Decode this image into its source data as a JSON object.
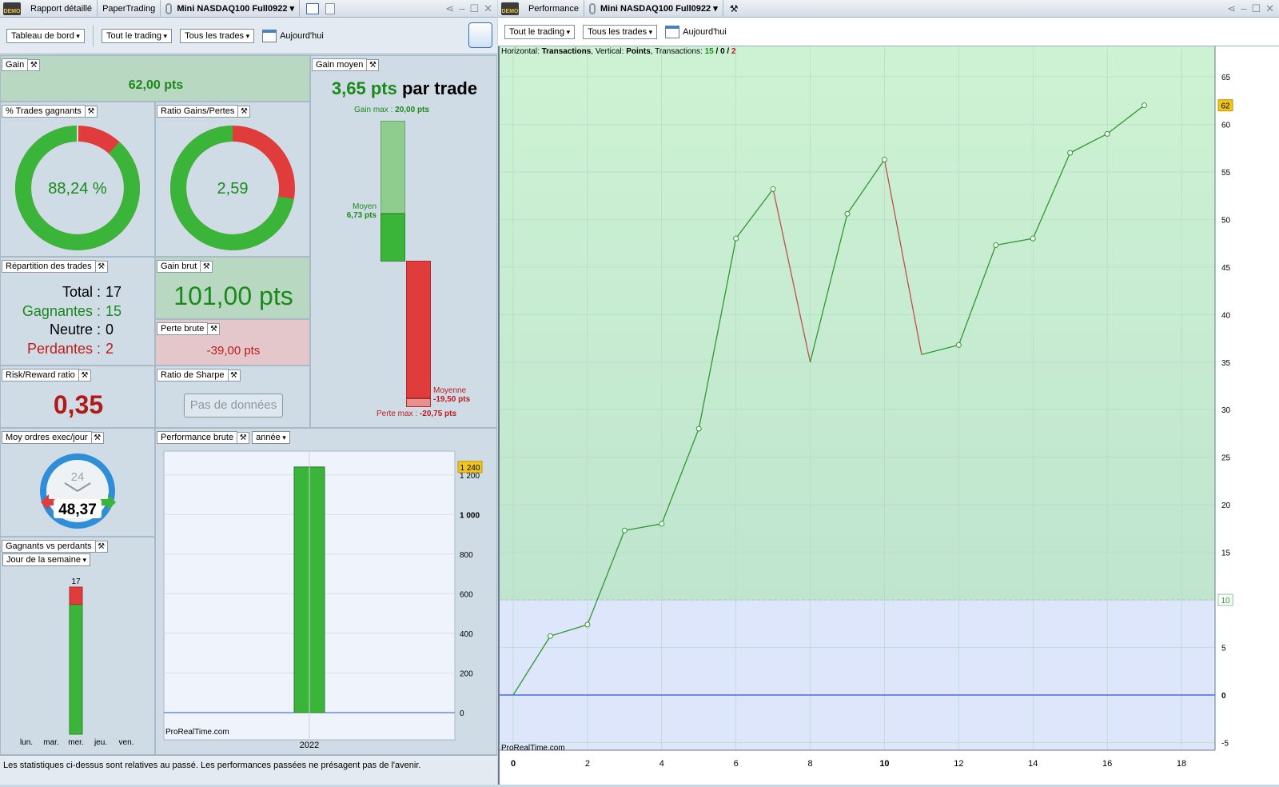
{
  "left_window": {
    "tabs": [
      "Rapport détaillé",
      "PaperTrading",
      "Mini NASDAQ100 Full0922"
    ],
    "toolbar": {
      "dashboard": "Tableau de bord",
      "scope": "Tout le trading",
      "trades": "Tous les trades",
      "date": "Aujourd'hui"
    }
  },
  "right_window": {
    "tabs": [
      "Performance",
      "Mini NASDAQ100 Full0922"
    ],
    "toolbar": {
      "scope": "Tout le trading",
      "trades": "Tous les trades",
      "date": "Aujourd'hui"
    }
  },
  "gain": {
    "label": "Gain",
    "value": "62,00 pts"
  },
  "gain_moyen": {
    "label": "Gain moyen",
    "value": "3,65 pts",
    "suffix": "par trade",
    "max_label": "Gain max :",
    "max_value": "20,00 pts",
    "avg_label": "Moyen",
    "avg_value": "6,73 pts",
    "loss_avg_label": "Moyenne",
    "loss_avg_value": "-19,50 pts",
    "loss_max_label": "Perte max :",
    "loss_max_value": "-20,75 pts",
    "gain_max_num": 20.0,
    "gain_avg_num": 6.73,
    "loss_avg_num": -19.5,
    "loss_max_num": -20.75
  },
  "pct_gagnants": {
    "label": "% Trades gagnants",
    "value": "88,24 %",
    "fraction": 0.8824
  },
  "ratio_gp": {
    "label": "Ratio Gains/Pertes",
    "value": "2,59",
    "gain_fraction": 0.7214
  },
  "repartition": {
    "label": "Répartition des trades",
    "total_label": "Total :",
    "total": "17",
    "win_label": "Gagnantes :",
    "win": "15",
    "neutral_label": "Neutre :",
    "neutral": "0",
    "loss_label": "Perdantes :",
    "loss": "2"
  },
  "gain_brut": {
    "label": "Gain brut",
    "value": "101,00 pts"
  },
  "perte_brute": {
    "label": "Perte brute",
    "value": "-39,00 pts"
  },
  "risk_reward": {
    "label": "Risk/Reward ratio",
    "value": "0,35"
  },
  "sharpe": {
    "label": "Ratio de Sharpe",
    "button": "Pas de données"
  },
  "moy_ordres": {
    "label": "Moy ordres exec/jour",
    "clock": "24",
    "value": "48,37"
  },
  "perf_brute": {
    "label": "Performance brute",
    "period": "année",
    "watermark": "ProRealTime.com",
    "current_tag": "1 240",
    "chart_data": {
      "type": "bar",
      "categories": [
        "2022"
      ],
      "values": [
        1240
      ],
      "ylim": [
        0,
        1300
      ],
      "yticks": [
        0,
        200,
        400,
        600,
        800,
        1000,
        1200
      ],
      "ytick_labels": [
        "0",
        "200",
        "400",
        "600",
        "800",
        "1 000",
        "1 200"
      ]
    }
  },
  "gagnants_vs_perdants": {
    "label": "Gagnants vs perdants",
    "period": "Jour de la semaine",
    "days": [
      "lun.",
      "mar.",
      "mer.",
      "jeu.",
      "ven."
    ],
    "top_label": "17",
    "chart_data": {
      "type": "bar",
      "categories": [
        "lun.",
        "mar.",
        "mer.",
        "jeu.",
        "ven."
      ],
      "series": [
        {
          "name": "Gagnants",
          "values": [
            0,
            0,
            15,
            0,
            0
          ]
        },
        {
          "name": "Perdants",
          "values": [
            0,
            0,
            2,
            0,
            0
          ]
        }
      ]
    }
  },
  "footer": "Les statistiques ci-dessus sont relatives au passé. Les performances passées ne présagent pas de l'avenir.",
  "performance_chart": {
    "info_h": "Horizontal:",
    "info_h_val": "Transactions",
    "info_v": ", Vertical:",
    "info_v_val": "Points",
    "info_t": ", Transactions:",
    "info_win": "15",
    "sep": "/",
    "info_neutral": "0",
    "info_loss": "2",
    "watermark": "ProRealTime.com",
    "current_tag": "62",
    "threshold_tag": "10",
    "colors": {
      "up": "#2e9a2e",
      "down": "#c0504d",
      "zero": "#3a4fd0",
      "green_zone": "#c8ecd0",
      "blue_zone": "#dde6fb"
    },
    "chart_data": {
      "type": "line",
      "x": [
        0,
        1,
        2,
        3,
        4,
        5,
        6,
        7,
        8,
        9,
        10,
        11,
        12,
        13,
        14,
        15,
        16,
        17
      ],
      "y": [
        0,
        6.2,
        7.4,
        17.3,
        18,
        28,
        48,
        53.2,
        35,
        50.6,
        56.3,
        35.8,
        36.8,
        47.3,
        48,
        57,
        59,
        62
      ],
      "xlim": [
        0,
        19
      ],
      "ylim": [
        -5.5,
        68
      ],
      "xticks": [
        0,
        2,
        4,
        6,
        8,
        10,
        12,
        14,
        16,
        18
      ],
      "yticks": [
        -5,
        0,
        5,
        10,
        15,
        20,
        25,
        30,
        35,
        40,
        45,
        50,
        55,
        60,
        65
      ],
      "threshold": 10
    }
  }
}
